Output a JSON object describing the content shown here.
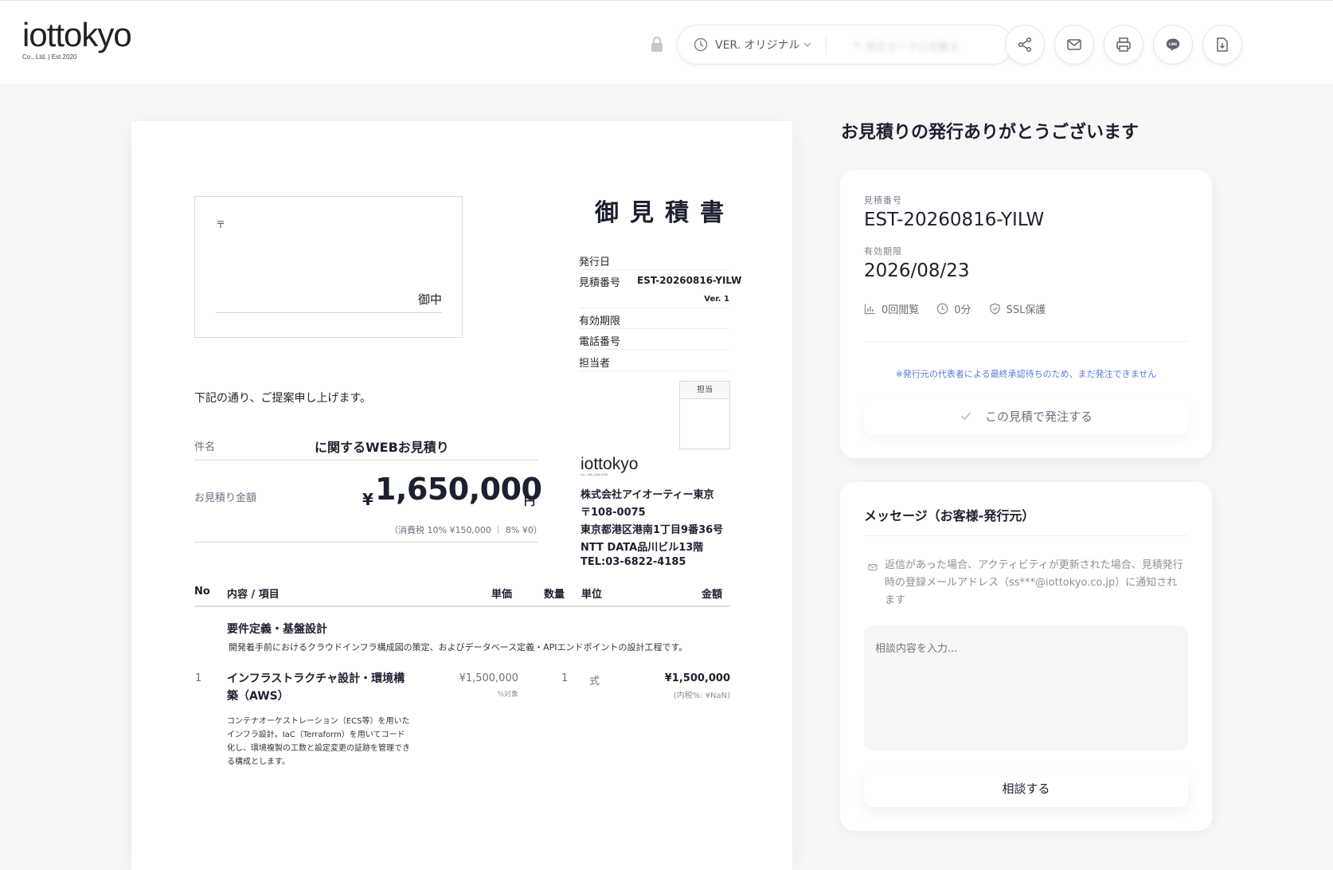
{
  "header": {
    "logo_word": "iottokyo",
    "logo_sub": "Co., Ltd. | Est.2020",
    "version_label": "VER. オリジナル",
    "edit_mode_label": "修正モードに切替え",
    "icons": [
      "lock-icon",
      "clock-icon",
      "chevron-down-icon",
      "share-icon",
      "mail-icon",
      "print-icon",
      "line-icon",
      "download-icon"
    ]
  },
  "document": {
    "postal_mark": "〒",
    "recipient_suffix": "御中",
    "title": "御見積書",
    "meta": {
      "issue_date_label": "発行日",
      "estimate_no_label": "見積番号",
      "estimate_no": "EST-20260816-YILW",
      "version": "Ver. 1",
      "valid_until_label": "有効期限",
      "phone_label": "電話番号",
      "staff_label": "担当者"
    },
    "stamp_label": "担当",
    "intro": "下記の通り、ご提案申し上げます。",
    "subject_label": "件名",
    "subject": "に関するWEBお見積り",
    "amount_label": "お見積り金額",
    "amount_currency": "¥",
    "amount": "1,650,000",
    "amount_unit": "円",
    "tax_note": "（消費税 10% ¥150,000 ｜ 8% ¥0）",
    "company": {
      "logo_word": "iottokyo",
      "logo_sub": "Co., Ltd. | Est.2020",
      "name": "株式会社アイオーティー東京",
      "postal": "〒108-0075",
      "address1": "東京都港区港南1丁目9番36号",
      "address2": "NTT DATA品川ビル13階",
      "tel": "TEL:03-6822-4185"
    },
    "table": {
      "headers": {
        "no": "No",
        "item": "内容 / 項目",
        "price": "単価",
        "qty": "数量",
        "unit": "単位",
        "amount": "金額"
      },
      "section": {
        "title": "要件定義・基盤設計",
        "description": "開発着手前におけるクラウドインフラ構成図の策定、およびデータベース定義・APIエンドポイントの設計工程です。"
      },
      "rows": [
        {
          "no": "1",
          "name": "インフラストラクチャ設計・環境構築（AWS）",
          "price": "¥1,500,000",
          "price_sub": "%対象",
          "qty": "1",
          "unit": "式",
          "amount": "¥1,500,000",
          "amount_sub": "(内税%: ¥NaN)",
          "description": "コンテナオーケストレーション（ECS等）を用いたインフラ設計。IaC（Terraform）を用いてコード化し、環境複製の工数と設定変更の証跡を管理できる構成とします。"
        }
      ]
    }
  },
  "sidebar": {
    "thanks": "お見積りの発行ありがとうございます",
    "estimate_no_label": "見積番号",
    "estimate_no": "EST-20260816-YILW",
    "valid_until_label": "有効期限",
    "valid_until": "2026/08/23",
    "views": "0回閲覧",
    "duration": "0分",
    "ssl": "SSL保護",
    "notice": "※発行元の代表者による最終承認待ちのため、まだ発注できません",
    "order_button": "この見積で発注する",
    "message_title": "メッセージ（お客様-発行元）",
    "message_note": "返信があった場合、アクティビティが更新された場合、見積発行時の登録メールアドレス（ss***@iottokyo.co.jp）に通知されます",
    "message_placeholder": "相談内容を入力...",
    "consult_button": "相談する"
  },
  "colors": {
    "accent_link": "#5a7bd5",
    "text_primary": "#1c2030",
    "text_muted": "#69707d"
  }
}
